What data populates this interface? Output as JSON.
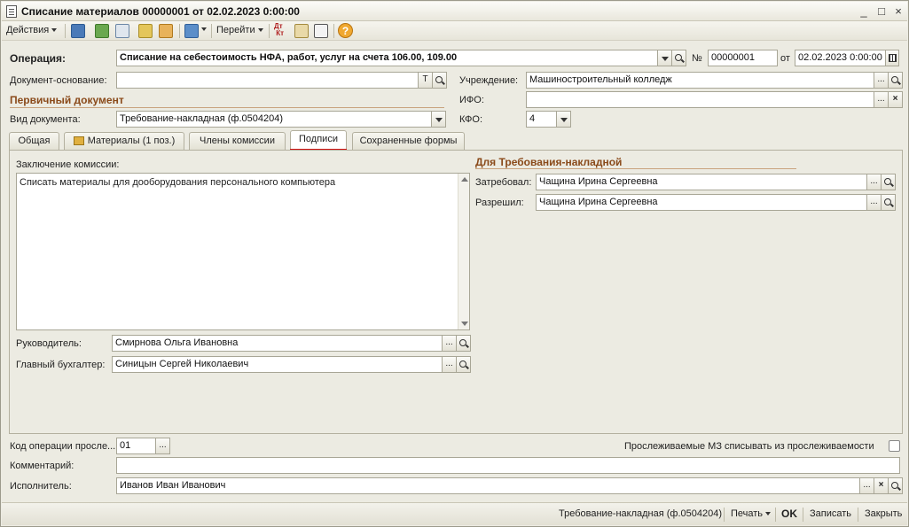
{
  "window": {
    "title": "Списание материалов 00000001 от 02.02.2023 0:00:00",
    "controls": [
      "_",
      "□",
      "×"
    ]
  },
  "toolbar": {
    "actions_label": "Действия",
    "goto_label": "Перейти",
    "icons": [
      "save-icon",
      "refresh-icon",
      "copy-icon",
      "post-icon",
      "unpost-icon",
      "documents-icon",
      "dt-kt-icon",
      "structure-icon",
      "report-icon",
      "help-icon"
    ]
  },
  "header": {
    "operation_label": "Операция:",
    "operation_value": "Списание на себестоимость НФА, работ, услуг на счета 106.00, 109.00",
    "number_label": "№",
    "number_value": "00000001",
    "date_label": "от",
    "date_value": "02.02.2023  0:00:00",
    "base_doc_label": "Документ-основание:",
    "base_doc_value": "",
    "base_doc_t": "T",
    "institution_label": "Учреждение:",
    "institution_value": "Машиностроительный колледж",
    "ifo_label": "ИФО:",
    "ifo_value": "",
    "kfo_label": "КФО:",
    "kfo_value": "4",
    "primary_doc_title": "Первичный документ",
    "doc_type_label": "Вид документа:",
    "doc_type_value": "Требование-накладная (ф.0504204)"
  },
  "tabs": [
    {
      "label": "Общая"
    },
    {
      "label": "Материалы (1 поз.)"
    },
    {
      "label": "Члены комиссии"
    },
    {
      "label": "Подписи"
    },
    {
      "label": "Сохраненные формы"
    }
  ],
  "panel": {
    "conclusion_label": "Заключение комиссии:",
    "conclusion_text": "Списать материалы для дооборудования персонального компьютера",
    "head_label": "Руководитель:",
    "head_value": "Смирнова Ольга Ивановна",
    "accountant_label": "Главный бухгалтер:",
    "accountant_value": "Синицын Сергей Николаевич",
    "req_title": "Для Требования-накладной",
    "requested_label": "Затребовал:",
    "requested_value": "Чащина Ирина Сергеевна",
    "allowed_label": "Разрешил:",
    "allowed_value": "Чащина Ирина Сергеевна"
  },
  "bottom": {
    "tracking_code_label": "Код операции просле...",
    "tracking_code_value": "01",
    "tracking_check_label": "Прослеживаемые МЗ списывать из прослеживаемости",
    "comment_label": "Комментарий:",
    "comment_value": "",
    "executor_label": "Исполнитель:",
    "executor_value": "Иванов Иван Иванович"
  },
  "statusbar": {
    "print_form": "Требование-накладная (ф.0504204)",
    "print_label": "Печать",
    "ok_label": "OK",
    "save_label": "Записать",
    "close_label": "Закрыть"
  },
  "colors": {
    "section_title": "#8a4a1a",
    "active_tab_underline": "#d01010",
    "window_bg": "#ecebe2"
  }
}
